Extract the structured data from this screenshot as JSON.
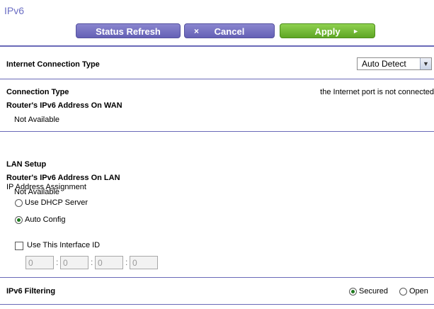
{
  "page": {
    "title": "IPv6"
  },
  "toolbar": {
    "refresh_label": "Status Refresh",
    "cancel_glyph": "×",
    "cancel_label": "Cancel",
    "apply_label": "Apply",
    "apply_glyph": "►"
  },
  "internet_connection": {
    "label": "Internet Connection Type",
    "selected": "Auto Detect"
  },
  "wan": {
    "connection_type_label": "Connection Type",
    "connection_status": "the Internet port is not connected",
    "ipv6_address_label": "Router's IPv6 Address On WAN",
    "ipv6_address_value": "Not Available"
  },
  "lan": {
    "title": "LAN Setup",
    "ipv6_address_label": "Router's IPv6 Address On LAN",
    "ipv6_address_value": "Not Available",
    "assignment_label": "IP Address Assignment",
    "options": [
      {
        "label": "Use DHCP Server",
        "selected": false
      },
      {
        "label": "Auto Config",
        "selected": true
      }
    ],
    "interface_id": {
      "label": "Use This Interface ID",
      "checked": false,
      "fields": [
        "0",
        "0",
        "0",
        "0"
      ],
      "separator": ":"
    }
  },
  "filtering": {
    "label": "IPv6 Filtering",
    "options": [
      {
        "label": "Secured",
        "selected": true
      },
      {
        "label": "Open",
        "selected": false
      }
    ]
  },
  "colors": {
    "accent": "#6a6ab8",
    "title": "#6c6fc4",
    "purple_button": "#6460b5",
    "green_button": "#5ea624"
  }
}
